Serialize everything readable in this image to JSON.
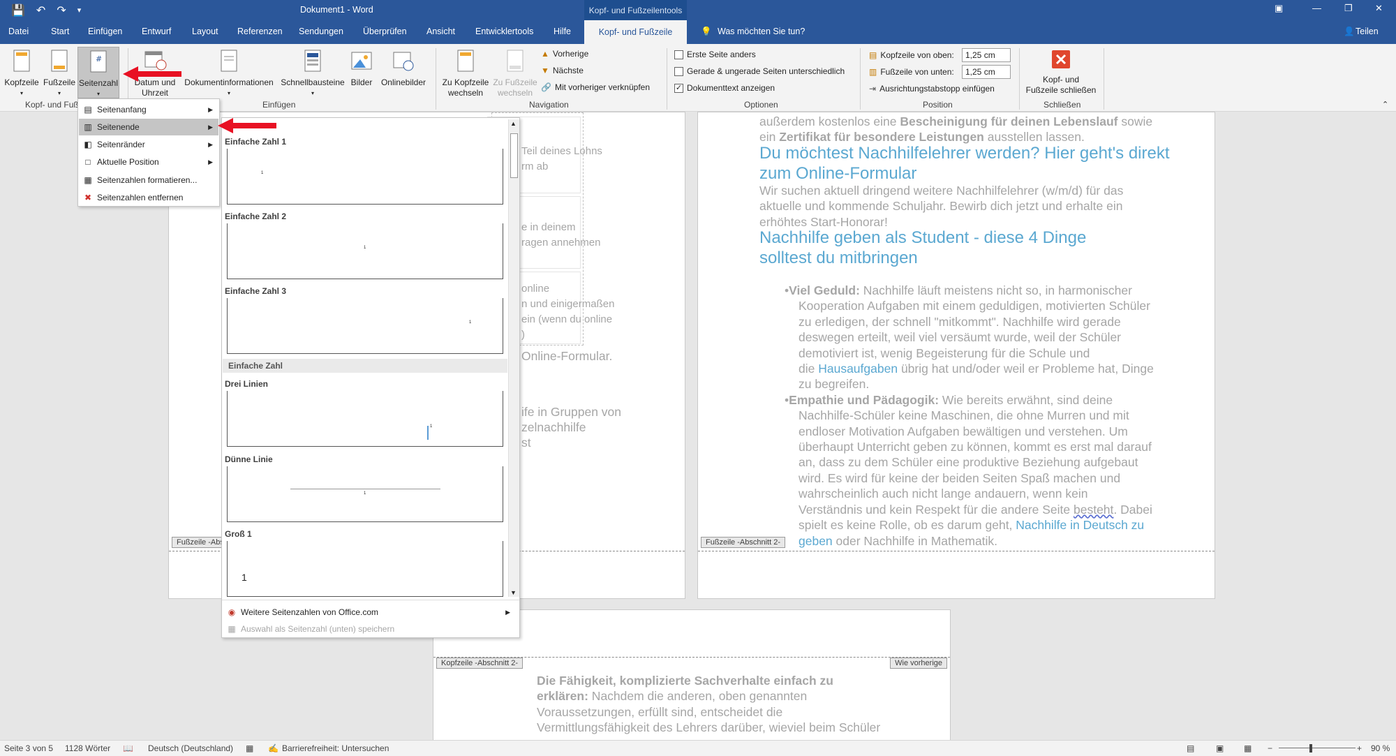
{
  "window": {
    "title": "Dokument1 - Word",
    "context_tools": "Kopf- und Fußzeilentools"
  },
  "tabs": [
    "Datei",
    "Start",
    "Einfügen",
    "Entwurf",
    "Layout",
    "Referenzen",
    "Sendungen",
    "Überprüfen",
    "Ansicht",
    "Entwicklertools",
    "Hilfe",
    "Kopf- und Fußzeile"
  ],
  "tellme": "Was möchten Sie tun?",
  "share": "Teilen",
  "ribbon": {
    "kopfzeile": "Kopfzeile",
    "fusszeile": "Fußzeile",
    "seitenzahl": "Seitenzahl",
    "datum1": "Datum und",
    "datum2": "Uhrzeit",
    "dokinfo": "Dokumentinformationen",
    "schnell": "Schnellbausteine",
    "bilder": "Bilder",
    "online": "Onlinebilder",
    "zukopf1": "Zu Kopfzeile",
    "zukopf2": "wechseln",
    "zufuss1": "Zu Fußzeile",
    "zufuss2": "wechseln",
    "vorherige": "Vorherige",
    "naechste": "Nächste",
    "verknuepfen": "Mit vorheriger verknüpfen",
    "erste": "Erste Seite anders",
    "gerade": "Gerade & ungerade Seiten unterschiedlich",
    "doktext": "Dokumenttext anzeigen",
    "kopf_oben": "Kopfzeile von oben:",
    "fuss_unten": "Fußzeile von unten:",
    "kopf_val": "1,25 cm",
    "fuss_val": "1,25 cm",
    "tabstopp": "Ausrichtungstabstopp einfügen",
    "schliessen1": "Kopf- und",
    "schliessen2": "Fußzeile schließen",
    "g_kopf": "Kopf- und Fuß",
    "g_einf": "Einfügen",
    "g_nav": "Navigation",
    "g_opt": "Optionen",
    "g_pos": "Position",
    "g_schl": "Schließen"
  },
  "menu": {
    "items": [
      "Seitenanfang",
      "Seitenende",
      "Seitenränder",
      "Aktuelle Position",
      "Seitenzahlen formatieren...",
      "Seitenzahlen entfernen"
    ]
  },
  "gallery": {
    "items": [
      "Einfache Zahl 1",
      "Einfache Zahl 2",
      "Einfache Zahl 3",
      "Drei Linien",
      "Dünne Linie",
      "Groß 1"
    ],
    "category": "Einfache Zahl",
    "num": "1",
    "more": "Weitere Seitenzahlen von Office.com",
    "save": "Auswahl als Seitenzahl (unten) speichern"
  },
  "page_left": {
    "t1": "Teil deines Lohns",
    "t2": "rm ab",
    "t3": "e in deinem",
    "t4": "ragen annehmen",
    "t5": "online",
    "t6": "n und einigermaßen",
    "t7": "ein (wenn du online",
    "t8": ")",
    "t9": "Online-Formular.",
    "t10": "ife in Gruppen von",
    "t11": "zelnachhilfe",
    "t12": "st",
    "footer_tag": "Fußzeile -Abs"
  },
  "page_right": {
    "l1a": "außerdem kostenlos eine ",
    "l1b": "Bescheinigung für deinen Lebenslauf",
    "l1c": " sowie",
    "l2a": "ein ",
    "l2b": "Zertifikat für besondere Leistungen",
    "l2c": " ausstellen lassen.",
    "h1": "Du möchtest Nachhilfelehrer werden? Hier geht's direkt",
    "h1b": "zum Online-Formular",
    "p1": "Wir suchen aktuell dringend weitere Nachhilfelehrer (w/m/d) für das",
    "p2": "aktuelle und kommende Schuljahr. Bewirb dich jetzt und erhalte ein",
    "p3": "erhöhtes Start-Honorar!",
    "h2": "Nachhilfe geben als Student - diese 4 Dinge",
    "h2b": "solltest du mitbringen",
    "b1t": "Viel Geduld:",
    "b1a": " Nachhilfe läuft meistens nicht so, in harmonischer",
    "b1b": "Kooperation Aufgaben mit einem geduldigen, motivierten Schüler",
    "b1c": "zu erledigen, der schnell \"mitkommt\". Nachhilfe wird gerade",
    "b1d": "deswegen erteilt, weil viel versäumt wurde, weil der Schüler",
    "b1e": "demotiviert ist, wenig Begeisterung für die Schule und",
    "b1f1": "die ",
    "b1f2": "Hausaufgaben",
    "b1f3": " übrig hat und/oder weil er Probleme hat, Dinge",
    "b1g": "zu begreifen.",
    "b2t": "Empathie und Pädagogik:",
    "b2a": " Wie bereits erwähnt, sind deine",
    "b2b": "Nachhilfe-Schüler keine Maschinen, die ohne Murren und mit",
    "b2c": "endloser Motivation Aufgaben bewältigen und verstehen. Um",
    "b2d": "überhaupt Unterricht geben zu können, kommt es erst mal darauf",
    "b2e": "an, dass zu dem Schüler eine produktive Beziehung aufgebaut",
    "b2f": "wird. Es wird für keine der beiden Seiten Spaß machen und",
    "b2g": "wahrscheinlich auch nicht lange andauern, wenn kein",
    "b2h1": "Verständnis und kein Respekt für die andere Seite ",
    "b2h2": "besteht",
    "b2h3": ". Dabei",
    "b2i1": "spielt es keine Rolle, ob es darum geht, ",
    "b2i2": "Nachhilfe in Deutsch zu",
    "b2j1": "geben",
    "b2j2": " oder Nachhilfe in Mathematik.",
    "footer_tag": "Fußzeile -Abschnitt 2-"
  },
  "page_bottom": {
    "header_tag": "Kopfzeile -Abschnitt 2-",
    "wie": "Wie vorherige",
    "l1": "Die Fähigkeit, komplizierte Sachverhalte einfach zu",
    "l2": "erklären:",
    "l2b": " Nachdem die anderen, oben genannten",
    "l3": "Voraussetzungen, erfüllt sind, entscheidet die",
    "l4": "Vermittlungsfähigkeit des Lehrers darüber, wieviel beim Schüler"
  },
  "status": {
    "page": "Seite 3 von 5",
    "words": "1128 Wörter",
    "lang": "Deutsch (Deutschland)",
    "access": "Barrierefreiheit: Untersuchen",
    "zoom": "90 %"
  },
  "colors": {
    "accent": "#2b579a",
    "link": "#5ba8d1",
    "arrow": "#e81123"
  }
}
